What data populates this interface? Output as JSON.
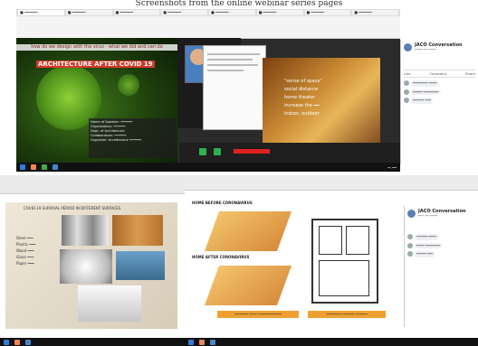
{
  "caption": "Screenshots from the online webinar series pages",
  "top_left": {
    "tabs": [
      "■ ━━━━━━",
      "■ ━━━━━━",
      "■ ━━━━━━",
      "■ ━━━━━━",
      "■ ━━━━━━",
      "■ ━━━━━━",
      "■ ━━━━━━",
      "■ ━━━━━━"
    ],
    "banner": "how do we design with the virus - what we did and can do",
    "slide_title": "ARCHITECTURE AFTER COVID 19",
    "meta_lines": [
      "Name of Speaker: ━━━━━━",
      "Organization: ━━━━━━",
      "Dept. of Architecture",
      "Collaborators: ━━━━━━",
      "Organizer: Architecture ━━━━━━"
    ],
    "right_overlay_lines": [
      "\"sense of space\"",
      "social distance",
      "home theater",
      "increase the ━━",
      "indoor, outdoor"
    ],
    "clock": "━:━━"
  },
  "top_right_fb": {
    "page_name": "JACO Conversation",
    "sub": "━━━━ ━━ ━━━━",
    "buttons": [
      "Like",
      "Comment",
      "Share"
    ],
    "comments": [
      "━━━━━━━━ ━━━━",
      "━━━━━ ━━━━━━━━",
      "━━━━━━ ━━━"
    ]
  },
  "bottom_left": {
    "slide_title": "COVID-19 SURVIVAL PERIOD IN DIFFERENT SURFACES",
    "rows": [
      {
        "label": "Steel",
        "value": "━━━"
      },
      {
        "label": "Plastic",
        "value": "━━━"
      },
      {
        "label": "Wood",
        "value": "━━━"
      },
      {
        "label": "Glass",
        "value": "━━━"
      },
      {
        "label": "Paper",
        "value": "━━━"
      }
    ]
  },
  "bottom_right": {
    "diagram_label_1": "HOME BEFORE CORONAVIRUS",
    "diagram_label_2": "HOME AFTER CORONAVIRUS",
    "footer_1": "━━━━━━━ ━━━━ ━━━━━━━━━━━━",
    "footer_2": "━━━━━━━━ ━━━━━━ ━━━━━━",
    "fb_name": "JACO Conversation",
    "fb_sub": "━━━ ━━ ━━━━",
    "comments": [
      "━━━━━━ ━━━━",
      "━━━━ ━━━━━━━━",
      "━━━━━ ━━━"
    ]
  },
  "colors": {
    "taskbar": "#111111",
    "slide_green": "#2e5e12",
    "fb_blue": "#1877f2",
    "warm_photo": "#c98a34"
  }
}
